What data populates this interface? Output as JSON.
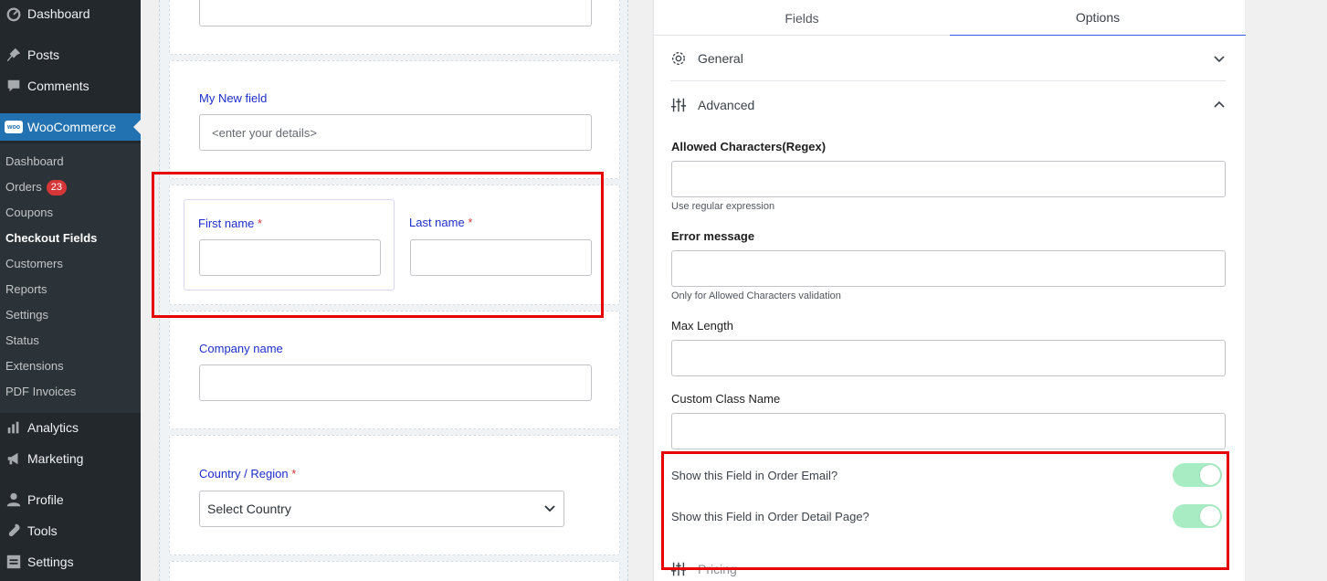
{
  "sidebar": {
    "top_items": [
      {
        "label": "Dashboard",
        "icon": "dashboard-icon"
      },
      {
        "label": "Posts",
        "icon": "pin-icon"
      },
      {
        "label": "Comments",
        "icon": "comment-icon"
      }
    ],
    "woocommerce": {
      "label": "WooCommerce",
      "logo_text": "woo"
    },
    "submenu": [
      {
        "label": "Dashboard"
      },
      {
        "label": "Orders",
        "badge": "23"
      },
      {
        "label": "Coupons"
      },
      {
        "label": "Checkout Fields",
        "current": true
      },
      {
        "label": "Customers"
      },
      {
        "label": "Reports"
      },
      {
        "label": "Settings"
      },
      {
        "label": "Status"
      },
      {
        "label": "Extensions"
      },
      {
        "label": "PDF Invoices"
      }
    ],
    "bottom_items": [
      {
        "label": "Analytics",
        "icon": "bar-chart-icon"
      },
      {
        "label": "Marketing",
        "icon": "megaphone-icon"
      },
      {
        "label": "Profile",
        "icon": "user-icon"
      },
      {
        "label": "Tools",
        "icon": "wrench-icon"
      },
      {
        "label": "Settings",
        "icon": "settings-icon"
      }
    ]
  },
  "form": {
    "my_new_field": {
      "label": "My New field",
      "placeholder": "<enter your details>"
    },
    "first_name": {
      "label": "First name",
      "required": "*"
    },
    "last_name": {
      "label": "Last name",
      "required": "*"
    },
    "company_name": {
      "label": "Company name"
    },
    "country": {
      "label": "Country / Region",
      "required": "*",
      "selected": "Select Country"
    }
  },
  "panel": {
    "tabs": [
      {
        "label": "Fields"
      },
      {
        "label": "Options",
        "active": true
      }
    ],
    "general": {
      "label": "General"
    },
    "advanced": {
      "label": "Advanced"
    },
    "allowed_chars": {
      "label": "Allowed Characters(Regex)",
      "help": "Use regular expression"
    },
    "error_message": {
      "label": "Error message",
      "help": "Only for Allowed Characters validation"
    },
    "max_length": {
      "label": "Max Length"
    },
    "custom_class": {
      "label": "Custom Class Name"
    },
    "show_email": {
      "label": "Show this Field in Order Email?",
      "on": true
    },
    "show_detail": {
      "label": "Show this Field in Order Detail Page?",
      "on": true
    },
    "pricing": {
      "label": "Pricing"
    }
  },
  "colors": {
    "highlight": "#e60000",
    "toggle_on": "#a8ecc4",
    "field_label": "#1d2ecc",
    "admin_bg": "#23282d",
    "woo_active": "#2271b1"
  }
}
